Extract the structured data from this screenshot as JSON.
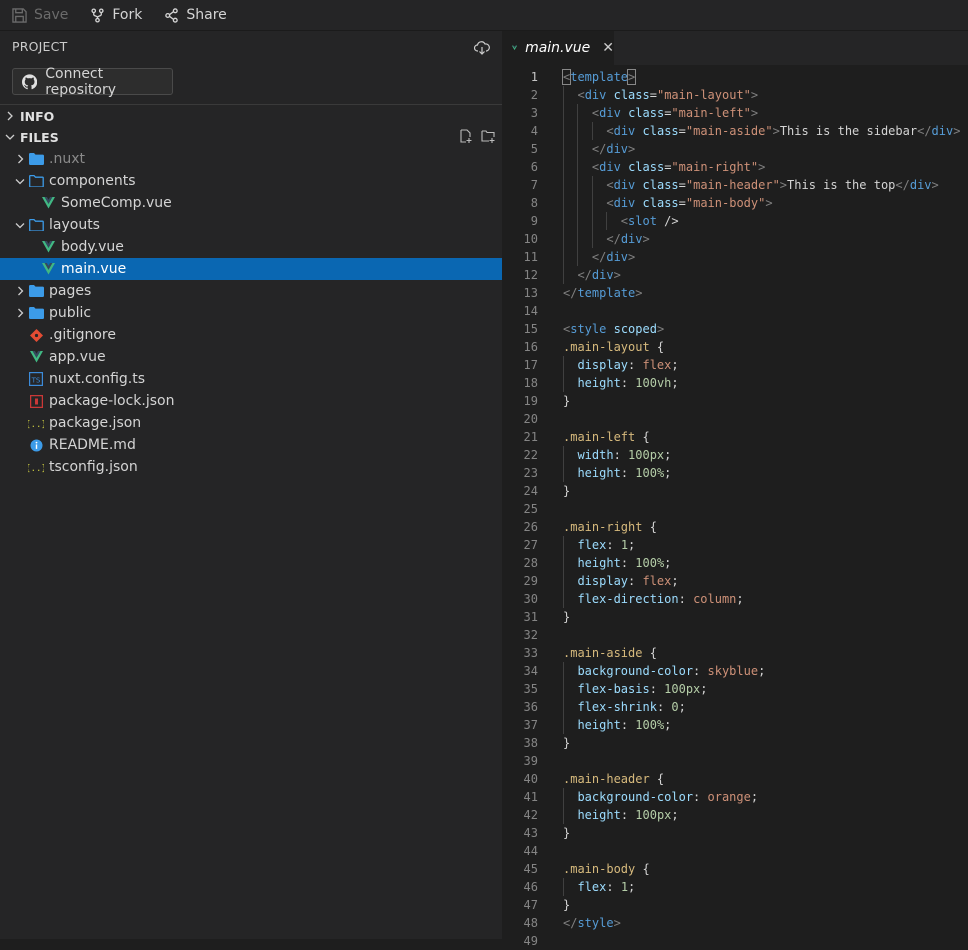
{
  "toolbar": {
    "save": "Save",
    "fork": "Fork",
    "share": "Share"
  },
  "sidebar": {
    "project_heading": "PROJECT",
    "connect_button": "Connect repository",
    "info_section": "INFO",
    "files_section": "FILES",
    "tree": [
      {
        "label": ".nuxt",
        "type": "folder",
        "depth": 0,
        "expanded": false,
        "dim": true
      },
      {
        "label": "components",
        "type": "folder",
        "depth": 0,
        "expanded": true
      },
      {
        "label": "SomeComp.vue",
        "type": "vue",
        "depth": 1
      },
      {
        "label": "layouts",
        "type": "folder",
        "depth": 0,
        "expanded": true
      },
      {
        "label": "body.vue",
        "type": "vue",
        "depth": 1
      },
      {
        "label": "main.vue",
        "type": "vue",
        "depth": 1,
        "selected": true
      },
      {
        "label": "pages",
        "type": "folder",
        "depth": 0,
        "expanded": false
      },
      {
        "label": "public",
        "type": "folder",
        "depth": 0,
        "expanded": false
      },
      {
        "label": ".gitignore",
        "type": "git",
        "depth": 0
      },
      {
        "label": "app.vue",
        "type": "vue",
        "depth": 0
      },
      {
        "label": "nuxt.config.ts",
        "type": "ts",
        "depth": 0
      },
      {
        "label": "package-lock.json",
        "type": "npm",
        "depth": 0
      },
      {
        "label": "package.json",
        "type": "json",
        "depth": 0
      },
      {
        "label": "README.md",
        "type": "info",
        "depth": 0
      },
      {
        "label": "tsconfig.json",
        "type": "json",
        "depth": 0
      }
    ]
  },
  "editor": {
    "tab_label": "main.vue",
    "active_line": 1,
    "lines": [
      "<template>",
      "  <div class=\"main-layout\">",
      "    <div class=\"main-left\">",
      "      <div class=\"main-aside\">This is the sidebar</div>",
      "    </div>",
      "    <div class=\"main-right\">",
      "      <div class=\"main-header\">This is the top</div>",
      "      <div class=\"main-body\">",
      "        <slot />",
      "      </div>",
      "    </div>",
      "  </div>",
      "</template>",
      "",
      "<style scoped>",
      ".main-layout {",
      "  display: flex;",
      "  height: 100vh;",
      "}",
      "",
      ".main-left {",
      "  width: 100px;",
      "  height: 100%;",
      "}",
      "",
      ".main-right {",
      "  flex: 1;",
      "  height: 100%;",
      "  display: flex;",
      "  flex-direction: column;",
      "}",
      "",
      ".main-aside {",
      "  background-color: skyblue;",
      "  flex-basis: 100px;",
      "  flex-shrink: 0;",
      "  height: 100%;",
      "}",
      "",
      ".main-header {",
      "  background-color: orange;",
      "  height: 100px;",
      "}",
      "",
      ".main-body {",
      "  flex: 1;",
      "}",
      "</style>",
      ""
    ]
  },
  "colors": {
    "selection": "#0a67b2",
    "vue_green": "#41b883",
    "folder_blue": "#3c9be8"
  }
}
